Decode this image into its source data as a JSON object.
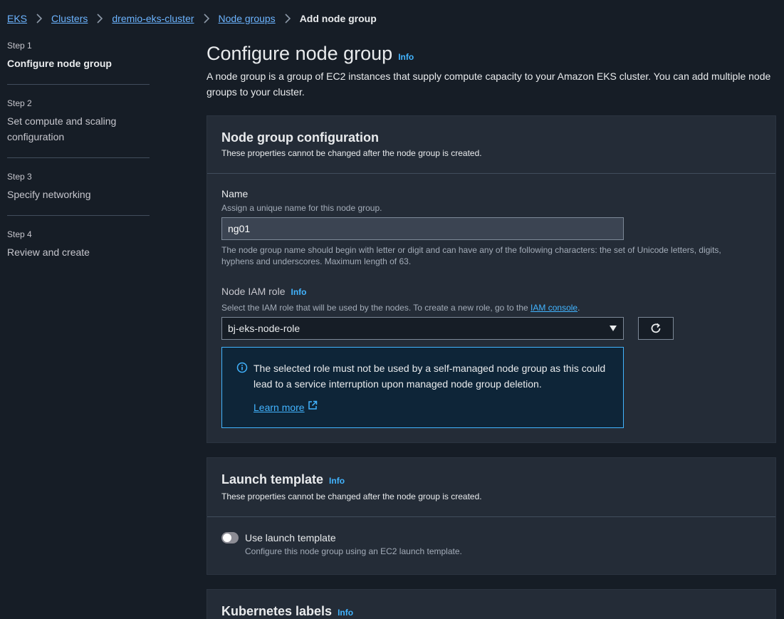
{
  "breadcrumb": {
    "items": [
      "EKS",
      "Clusters",
      "dremio-eks-cluster",
      "Node groups"
    ],
    "current": "Add node group"
  },
  "steps": [
    {
      "num": "Step 1",
      "title": "Configure node group"
    },
    {
      "num": "Step 2",
      "title": "Set compute and scaling configuration"
    },
    {
      "num": "Step 3",
      "title": "Specify networking"
    },
    {
      "num": "Step 4",
      "title": "Review and create"
    }
  ],
  "page": {
    "title": "Configure node group",
    "info": "Info",
    "description": "A node group is a group of EC2 instances that supply compute capacity to your Amazon EKS cluster. You can add multiple node groups to your cluster."
  },
  "node_group_config": {
    "title": "Node group configuration",
    "subtitle": "These properties cannot be changed after the node group is created.",
    "name_label": "Name",
    "name_desc": "Assign a unique name for this node group.",
    "name_value": "ng01",
    "name_constraint": "The node group name should begin with letter or digit and can have any of the following characters: the set of Unicode letters, digits, hyphens and underscores. Maximum length of 63.",
    "role_label": "Node IAM role",
    "role_info": "Info",
    "role_desc_prefix": "Select the IAM role that will be used by the nodes. To create a new role, go to the ",
    "role_desc_link": "IAM console",
    "role_desc_suffix": ".",
    "role_value": "bj-eks-node-role",
    "alert_text": "The selected role must not be used by a self-managed node group as this could lead to a service interruption upon managed node group deletion.",
    "alert_link": "Learn more"
  },
  "launch_template": {
    "title": "Launch template",
    "info": "Info",
    "subtitle": "These properties cannot be changed after the node group is created.",
    "toggle_label": "Use launch template",
    "toggle_desc": "Configure this node group using an EC2 launch template.",
    "toggle_on": false
  },
  "k8s_labels": {
    "title": "Kubernetes labels",
    "info": "Info"
  },
  "colors": {
    "link": "#42b4ff",
    "background": "#161d26",
    "card": "#242c37"
  }
}
